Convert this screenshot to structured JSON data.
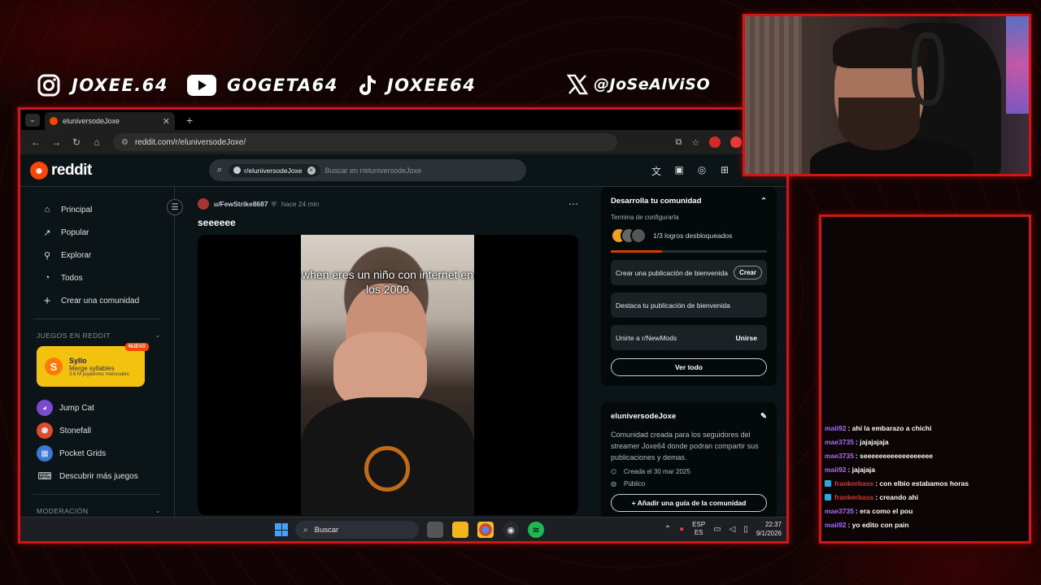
{
  "colors": {
    "accent_red": "#d11616",
    "reddit_orange": "#ff4500",
    "chat_user_violet": "#b06bff",
    "chat_user_red": "#e03030"
  },
  "socials": [
    {
      "icon": "instagram-icon",
      "handle": "JOXEE.64"
    },
    {
      "icon": "youtube-icon",
      "handle": "GOGETA64"
    },
    {
      "icon": "tiktok-icon",
      "handle": "JOXEE64"
    },
    {
      "icon": "x-icon",
      "handle": "@JoSeAlViSO"
    }
  ],
  "browser": {
    "tab_title": "eluniversodeJoxe",
    "url": "reddit.com/r/eluniversodeJoxe/"
  },
  "reddit": {
    "brand": "reddit",
    "search_chip": "r/eluniversodeJoxe",
    "search_placeholder": "Buscar en r/eluniversodeJoxe",
    "nav": [
      {
        "icon": "home-icon",
        "label": "Principal"
      },
      {
        "icon": "popular-icon",
        "label": "Popular"
      },
      {
        "icon": "explore-icon",
        "label": "Explorar"
      },
      {
        "icon": "all-icon",
        "label": "Todos"
      },
      {
        "icon": "plus-icon",
        "label": "Crear una comunidad"
      }
    ],
    "games_section": "JUEGOS EN REDDIT",
    "featured_game": {
      "name": "Syllo",
      "subtitle": "Merge syllables",
      "players": "3.6 M jugadores mensuales",
      "badge": "NUEVO"
    },
    "games": [
      {
        "label": "Jump Cat",
        "color": "#7a4ad0",
        "glyph": "🐱"
      },
      {
        "label": "Stonefall",
        "color": "#e04a2a",
        "glyph": "⬢"
      },
      {
        "label": "Pocket Grids",
        "color": "#3a78d8",
        "glyph": "▦"
      }
    ],
    "discover_games": "Descubrir más juegos",
    "moderation_section": "MODERACIÓN",
    "post": {
      "user": "u/FewStrike8687",
      "time": "hace 24 min",
      "title": "seeeeee",
      "video_caption": "when eres un niño con internet en los 2000"
    },
    "community_setup": {
      "title": "Desarrolla tu comunidad",
      "subtitle": "Termina de configurarla",
      "achievements": "1/3 logros desbloqueados",
      "progress": 0.33,
      "tasks": [
        {
          "label": "Crear una publicación de bienvenida",
          "action": "Crear",
          "type": "button"
        },
        {
          "label": "Destaca tu publicación de bienvenida",
          "action": "",
          "type": "none"
        },
        {
          "label": "Unirte a r/NewMods",
          "action": "Unirse",
          "type": "link"
        }
      ],
      "view_all": "Ver todo"
    },
    "about": {
      "name": "eluniversodeJoxe",
      "description": "Comunidad creada para los seguidores del streamer Joxe64 donde podran compartir sus publicaciones y demas.",
      "created": "Creada el 30 mar 2025",
      "visibility": "Público",
      "guide_button": "Añadir una guía de la comunidad"
    }
  },
  "taskbar": {
    "search": "Buscar",
    "lang_top": "ESP",
    "lang_bottom": "ES",
    "time": "22:37",
    "date": "9/1/2026"
  },
  "chat": [
    {
      "user": "maii92",
      "text": ": ahí la embarazo a chichi",
      "color": "#b06bff",
      "icon": false
    },
    {
      "user": "mae3735",
      "text": ": jajajajaja",
      "color": "#b06bff",
      "icon": false
    },
    {
      "user": "mae3735",
      "text": ": seeeeeeeeeeeeeeeeee",
      "color": "#b06bff",
      "icon": false
    },
    {
      "user": "maii92",
      "text": ": jajajaja",
      "color": "#b06bff",
      "icon": false
    },
    {
      "user": "frankerbass",
      "text": ": con elbio estabamos horas",
      "color": "#e03030",
      "icon": true
    },
    {
      "user": "frankerbass",
      "text": ": creando ahi",
      "color": "#e03030",
      "icon": true
    },
    {
      "user": "mae3735",
      "text": ": era como el pou",
      "color": "#b06bff",
      "icon": false
    },
    {
      "user": "maii92",
      "text": ": yo edito con pain",
      "color": "#b06bff",
      "icon": false
    }
  ]
}
